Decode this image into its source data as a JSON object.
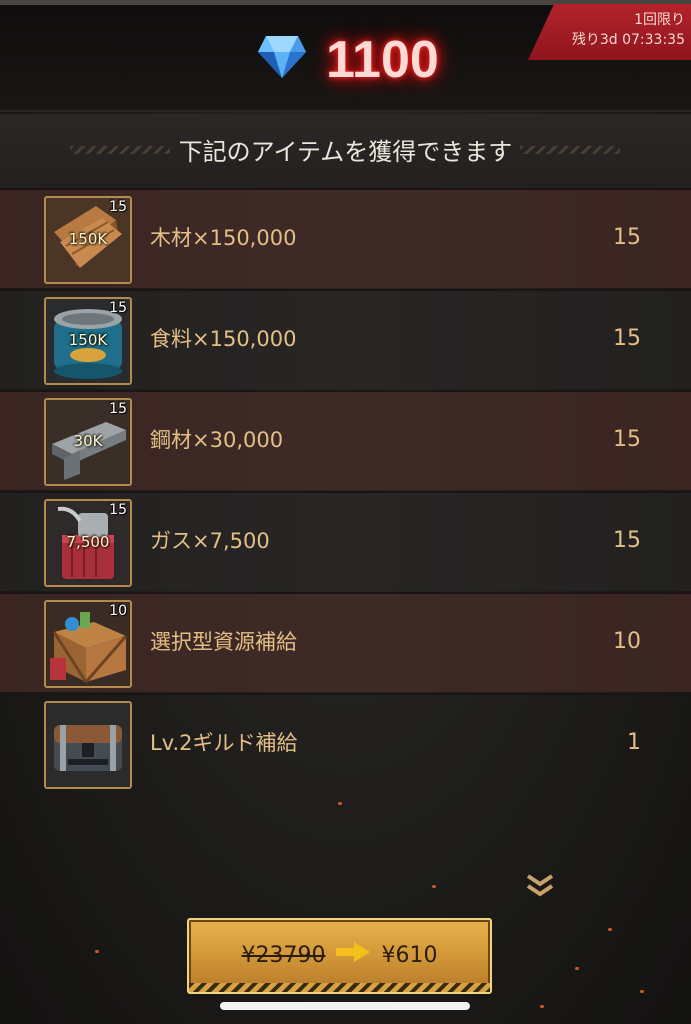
{
  "header": {
    "gem_icon": "diamond-gem-icon",
    "gem_count": "1100",
    "limit_title": "1回限り",
    "limit_remaining": "残り3d 07:33:35"
  },
  "section_title": "下記のアイテムを獲得できます",
  "items": [
    {
      "icon": "wood-plank-icon",
      "badge_qty": "15",
      "badge_amount": "150K",
      "name": "木材×150,000",
      "count": "15"
    },
    {
      "icon": "food-can-icon",
      "badge_qty": "15",
      "badge_amount": "150K",
      "name": "食料×150,000",
      "count": "15"
    },
    {
      "icon": "steel-anvil-icon",
      "badge_qty": "15",
      "badge_amount": "30K",
      "name": "鋼材×30,000",
      "count": "15"
    },
    {
      "icon": "gas-canister-icon",
      "badge_qty": "15",
      "badge_amount": "7,500",
      "name": "ガス×7,500",
      "count": "15"
    },
    {
      "icon": "resource-crate-icon",
      "badge_qty": "10",
      "badge_amount": "",
      "name": "選択型資源補給",
      "count": "10"
    },
    {
      "icon": "guild-chest-icon",
      "badge_qty": "",
      "badge_amount": "",
      "name": "Lv.2ギルド補給",
      "count": "1"
    }
  ],
  "purchase": {
    "old_price": "¥23790",
    "new_price": "¥610",
    "arrow_icon": "arrow-right-icon"
  },
  "colors": {
    "accent_text": "#e3bf86",
    "gem_glow": "#e01414",
    "badge_red": "#b3232b",
    "button_gold": "#cf9436"
  }
}
